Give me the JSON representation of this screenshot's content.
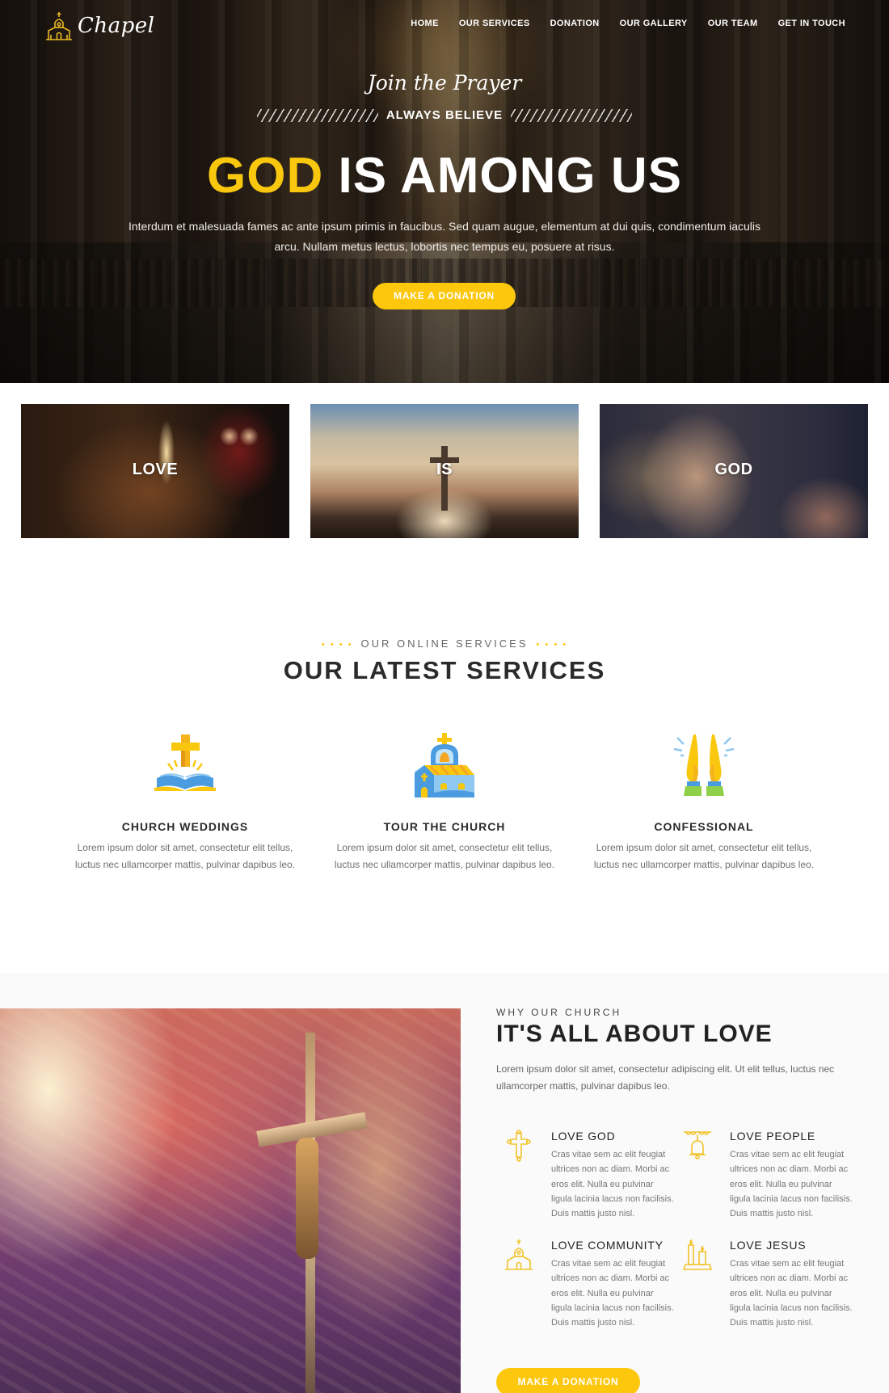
{
  "brand": {
    "name": "Chapel",
    "logo_icon": "church-icon"
  },
  "nav": {
    "items": [
      "HOME",
      "OUR SERVICES",
      "DONATION",
      "OUR GALLERY",
      "OUR TEAM",
      "GET IN TOUCH"
    ]
  },
  "hero": {
    "script": "Join the Prayer",
    "tagline": "ALWAYS BELIEVE",
    "title_accent": "GOD",
    "title_rest": "IS AMONG US",
    "description": "Interdum et malesuada fames ac ante ipsum primis in faucibus. Sed quam augue, elementum at dui quis, condimentum iaculis arcu. Nullam metus lectus, lobortis nec tempus eu, posuere at risus.",
    "button": "MAKE A DONATION"
  },
  "cards": [
    {
      "label": "LOVE"
    },
    {
      "label": "IS"
    },
    {
      "label": "GOD"
    }
  ],
  "services": {
    "eyebrow": "OUR ONLINE SERVICES",
    "eyebrow_dots": "• • • •",
    "title": "OUR LATEST SERVICES",
    "items": [
      {
        "icon": "bible-cross-icon",
        "title": "CHURCH WEDDINGS",
        "text": "Lorem ipsum dolor sit amet, consectetur elit tellus, luctus nec ullamcorper mattis, pulvinar dapibus leo."
      },
      {
        "icon": "church-bell-icon",
        "title": "TOUR THE CHURCH",
        "text": "Lorem ipsum dolor sit amet, consectetur elit tellus, luctus nec ullamcorper mattis, pulvinar dapibus leo."
      },
      {
        "icon": "praying-hands-icon",
        "title": "CONFESSIONAL",
        "text": "Lorem ipsum dolor sit amet, consectetur elit tellus, luctus nec ullamcorper mattis, pulvinar dapibus leo."
      }
    ]
  },
  "about": {
    "eyebrow": "WHY OUR CHURCH",
    "title": "IT'S ALL ABOUT LOVE",
    "description": "Lorem ipsum dolor sit amet, consectetur adipiscing elit. Ut elit tellus, luctus nec ullamcorper mattis, pulvinar dapibus leo.",
    "features": [
      {
        "icon": "cross-icon",
        "title": "LOVE GOD",
        "text": "Cras vitae sem ac elit feugiat ultrices non ac diam. Morbi ac eros elit. Nulla eu pulvinar ligula lacinia lacus non facilisis. Duis mattis justo nisl."
      },
      {
        "icon": "bell-icon",
        "title": "LOVE PEOPLE",
        "text": "Cras vitae sem ac elit feugiat ultrices non ac diam. Morbi ac eros elit. Nulla eu pulvinar ligula lacinia lacus non facilisis. Duis mattis justo nisl."
      },
      {
        "icon": "church-icon",
        "title": "LOVE COMMUNITY",
        "text": "Cras vitae sem ac elit feugiat ultrices non ac diam. Morbi ac eros elit. Nulla eu pulvinar ligula lacinia lacus non facilisis. Duis mattis justo nisl."
      },
      {
        "icon": "candles-icon",
        "title": "LOVE JESUS",
        "text": "Cras vitae sem ac elit feugiat ultrices non ac diam. Morbi ac eros elit. Nulla eu pulvinar ligula lacinia lacus non facilisis. Duis mattis justo nisl."
      }
    ],
    "button": "MAKE A DONATION"
  },
  "colors": {
    "accent": "#fcc70c",
    "text_dark": "#2b2b2b",
    "text_muted": "#6f6f6f",
    "section_bg": "#fafafa"
  }
}
